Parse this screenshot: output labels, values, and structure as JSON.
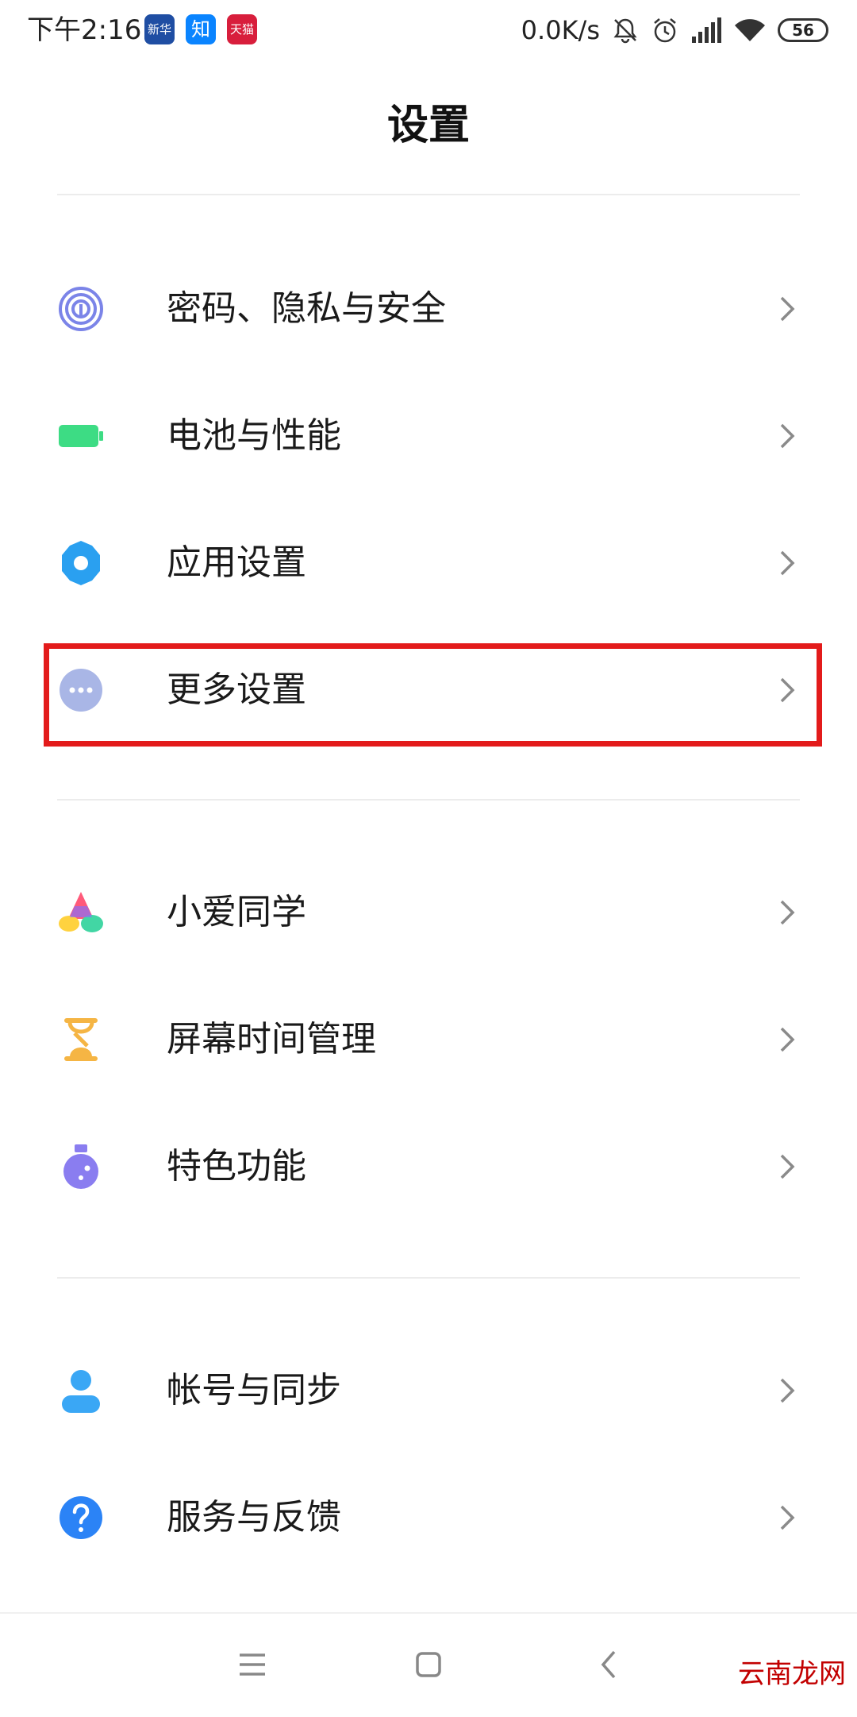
{
  "status_bar": {
    "time": "下午2:16",
    "notifications": [
      {
        "name": "news-app-icon",
        "label": "新华社",
        "color": "#1f4ea3"
      },
      {
        "name": "zhihu-app-icon",
        "label": "知",
        "color": "#0a84ff"
      },
      {
        "name": "tmall-app-icon",
        "label": "天猫",
        "color": "#d81e3c"
      }
    ],
    "net_speed": "0.0K/s",
    "battery": "56"
  },
  "page": {
    "title": "设置"
  },
  "groups": [
    [
      {
        "id": "privacy",
        "label": "密码、隐私与安全",
        "icon": "fingerprint-icon",
        "color": "#7b84e8"
      },
      {
        "id": "battery",
        "label": "电池与性能",
        "icon": "battery-icon",
        "color": "#3ddc84"
      },
      {
        "id": "apps",
        "label": "应用设置",
        "icon": "gear-icon",
        "color": "#2aa0f0"
      },
      {
        "id": "more",
        "label": "更多设置",
        "icon": "more-dots-icon",
        "color": "#a9b6e6"
      }
    ],
    [
      {
        "id": "xiaoai",
        "label": "小爱同学",
        "icon": "xiaoai-icon",
        "color": "#ff5a7a"
      },
      {
        "id": "screen-time",
        "label": "屏幕时间管理",
        "icon": "hourglass-icon",
        "color": "#f5b544"
      },
      {
        "id": "features",
        "label": "特色功能",
        "icon": "flask-icon",
        "color": "#8a7df0"
      }
    ],
    [
      {
        "id": "account",
        "label": "帐号与同步",
        "icon": "person-icon",
        "color": "#3aa7f5"
      },
      {
        "id": "service",
        "label": "服务与反馈",
        "icon": "question-icon",
        "color": "#2b83f6"
      }
    ]
  ],
  "highlighted_item": "更多设置",
  "watermark": "云南龙网"
}
